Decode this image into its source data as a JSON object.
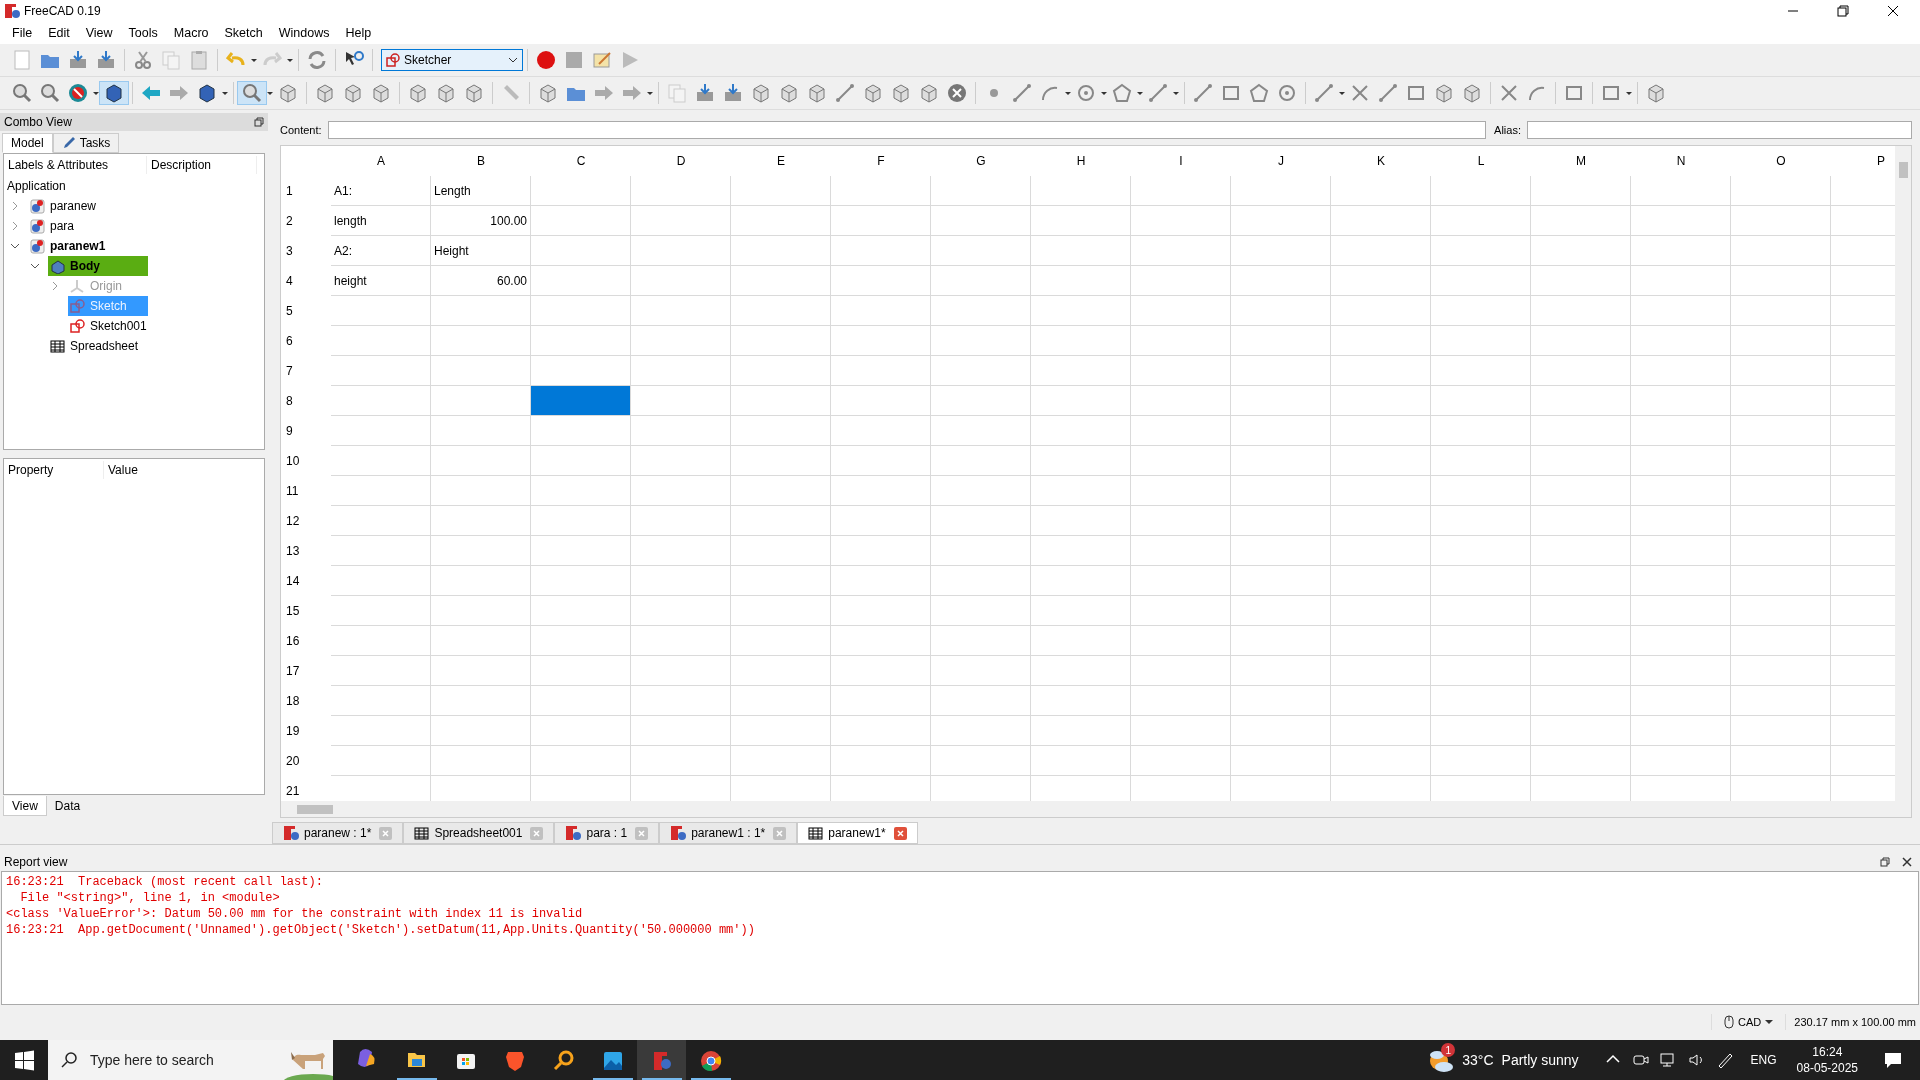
{
  "window": {
    "title": "FreeCAD 0.19"
  },
  "menu": [
    "File",
    "Edit",
    "View",
    "Tools",
    "Macro",
    "Sketch",
    "Windows",
    "Help"
  ],
  "workbench": {
    "value": "Sketcher"
  },
  "combo_view": {
    "title": "Combo View",
    "tabs": [
      {
        "label": "Model",
        "selected": true
      },
      {
        "label": "Tasks",
        "selected": false
      }
    ],
    "tree_columns": [
      "Labels & Attributes",
      "Description"
    ],
    "tree_root": "Application",
    "tree": [
      {
        "label": "paranew",
        "kind": "document",
        "expanded": false,
        "active": false,
        "selected": false,
        "hidden": false
      },
      {
        "label": "para",
        "kind": "document",
        "expanded": false,
        "active": false,
        "selected": false,
        "hidden": false
      },
      {
        "label": "paranew1",
        "kind": "document",
        "expanded": true,
        "active": true,
        "selected": false,
        "hidden": false,
        "children": [
          {
            "label": "Body",
            "kind": "body",
            "expanded": true,
            "active": true,
            "selected": false,
            "hidden": false,
            "children": [
              {
                "label": "Origin",
                "kind": "origin",
                "expanded": false,
                "active": false,
                "selected": false,
                "hidden": true
              },
              {
                "label": "Sketch",
                "kind": "sketch",
                "active": false,
                "selected": true,
                "hidden": true
              },
              {
                "label": "Sketch001",
                "kind": "sketch",
                "active": false,
                "selected": false,
                "hidden": false
              }
            ]
          },
          {
            "label": "Spreadsheet",
            "kind": "spreadsheet",
            "active": false,
            "selected": false,
            "hidden": false
          }
        ]
      }
    ],
    "property_columns": [
      "Property",
      "Value"
    ],
    "property_tabs": [
      {
        "label": "View",
        "selected": true
      },
      {
        "label": "Data",
        "selected": false
      }
    ]
  },
  "sheet": {
    "content_label": "Content:",
    "alias_label": "Alias:",
    "columns": [
      "A",
      "B",
      "C",
      "D",
      "E",
      "F",
      "G",
      "H",
      "I",
      "J",
      "K",
      "L",
      "M",
      "N",
      "O",
      "P"
    ],
    "rows": [
      {
        "label": "1",
        "cells": [
          {
            "text": "A1:",
            "kind": "text",
            "selected": false
          },
          {
            "text": "Length",
            "kind": "text",
            "selected": false
          }
        ]
      },
      {
        "label": "2",
        "cells": [
          {
            "text": "length",
            "kind": "text",
            "selected": false
          },
          {
            "text": "100.00",
            "kind": "number",
            "selected": false
          }
        ]
      },
      {
        "label": "3",
        "cells": [
          {
            "text": "A2:",
            "kind": "text",
            "selected": false
          },
          {
            "text": "Height",
            "kind": "text",
            "selected": false
          }
        ]
      },
      {
        "label": "4",
        "cells": [
          {
            "text": "height",
            "kind": "text",
            "selected": false
          },
          {
            "text": "60.00",
            "kind": "number",
            "selected": false
          }
        ]
      },
      {
        "label": "5"
      },
      {
        "label": "6"
      },
      {
        "label": "7"
      },
      {
        "label": "8",
        "cells": [
          {
            "kind": "text",
            "selected": false
          },
          {
            "kind": "text",
            "selected": false
          },
          {
            "kind": "text",
            "selected": true
          }
        ]
      },
      {
        "label": "9"
      },
      {
        "label": "10"
      },
      {
        "label": "11"
      },
      {
        "label": "12"
      },
      {
        "label": "13"
      },
      {
        "label": "14"
      },
      {
        "label": "15"
      },
      {
        "label": "16"
      },
      {
        "label": "17"
      },
      {
        "label": "18"
      },
      {
        "label": "19"
      },
      {
        "label": "20"
      },
      {
        "label": "21"
      }
    ]
  },
  "document_tabs": [
    {
      "label": "paranew : 1*",
      "kind": "document",
      "selected": false
    },
    {
      "label": "Spreadsheet001",
      "kind": "spreadsheet",
      "selected": false
    },
    {
      "label": "para : 1",
      "kind": "document",
      "selected": false
    },
    {
      "label": "paranew1 : 1*",
      "kind": "document",
      "selected": false
    },
    {
      "label": "paranew1*",
      "kind": "spreadsheet",
      "selected": true
    }
  ],
  "report_view": {
    "title": "Report view",
    "lines": [
      "16:23:21  Traceback (most recent call last):",
      "  File \"<string>\", line 1, in <module>",
      "<class 'ValueError'>: Datum 50.00 mm for the constraint with index 11 is invalid",
      "16:23:21  App.getDocument('Unnamed').getObject('Sketch').setDatum(11,App.Units.Quantity('50.000000 mm'))"
    ]
  },
  "status_bar": {
    "navigation": "CAD",
    "dimensions": "230.17 mm x 100.00 mm"
  },
  "taskbar": {
    "search": {
      "placeholder": "Type here to search"
    },
    "apps": [
      {
        "kind": "copilot",
        "running": false,
        "selected": false
      },
      {
        "kind": "files",
        "running": true,
        "selected": false
      },
      {
        "kind": "store",
        "running": false,
        "selected": false
      },
      {
        "kind": "brave",
        "running": false,
        "selected": false
      },
      {
        "kind": "search",
        "running": false,
        "selected": false
      },
      {
        "kind": "photos",
        "running": true,
        "selected": false
      },
      {
        "kind": "freecad",
        "running": true,
        "selected": true
      },
      {
        "kind": "chrome",
        "running": true,
        "selected": false
      }
    ],
    "weather": {
      "badge": "1",
      "temperature": "33°C",
      "condition": "Partly sunny"
    },
    "language": "ENG",
    "time": "16:24",
    "date": "08-05-2025"
  }
}
